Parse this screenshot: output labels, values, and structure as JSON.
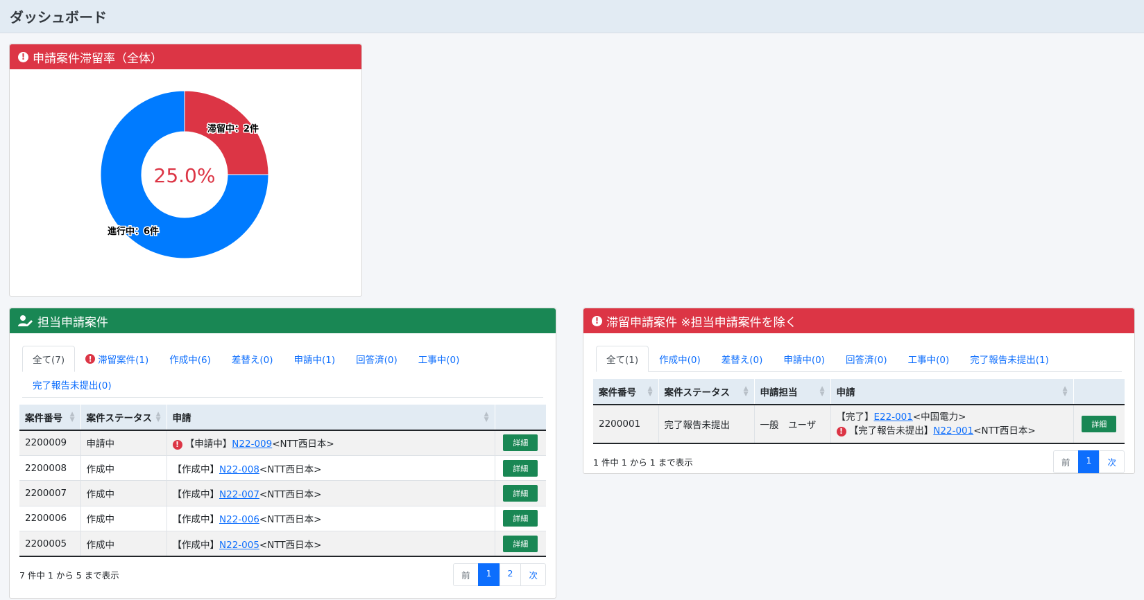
{
  "page": {
    "title": "ダッシュボード"
  },
  "rate_card": {
    "title": "申請案件滞留率（全体）",
    "center_label": "25.0%",
    "slices": [
      {
        "label": "滞留中：2件",
        "value": 2,
        "color": "#dc3545"
      },
      {
        "label": "進行中：6件",
        "value": 6,
        "color": "#007bff"
      }
    ]
  },
  "assigned": {
    "title": "担当申請案件",
    "tabs": [
      "全て(7)",
      "滞留案件(1)",
      "作成中(6)",
      "差替え(0)",
      "申請中(1)",
      "回答済(0)",
      "工事中(0)",
      "完了報告未提出(0)"
    ],
    "columns": [
      "案件番号",
      "案件ステータス",
      "申請"
    ],
    "rows": [
      {
        "no": "2200009",
        "status": "申請中",
        "alert": true,
        "prefix": "【申請中】",
        "link": "N22-009",
        "suffix": "<NTT西日本>"
      },
      {
        "no": "2200008",
        "status": "作成中",
        "alert": false,
        "prefix": "【作成中】",
        "link": "N22-008",
        "suffix": "<NTT西日本>"
      },
      {
        "no": "2200007",
        "status": "作成中",
        "alert": false,
        "prefix": "【作成中】",
        "link": "N22-007",
        "suffix": "<NTT西日本>"
      },
      {
        "no": "2200006",
        "status": "作成中",
        "alert": false,
        "prefix": "【作成中】",
        "link": "N22-006",
        "suffix": "<NTT西日本>"
      },
      {
        "no": "2200005",
        "status": "作成中",
        "alert": false,
        "prefix": "【作成中】",
        "link": "N22-005",
        "suffix": "<NTT西日本>"
      }
    ],
    "detail_label": "詳細",
    "info": "7 件中 1 から 5 まで表示",
    "pager": [
      "前",
      "1",
      "2",
      "次"
    ],
    "current_page": "1"
  },
  "stalled": {
    "title": "滞留申請案件 ※担当申請案件を除く",
    "tabs": [
      "全て(1)",
      "作成中(0)",
      "差替え(0)",
      "申請中(0)",
      "回答済(0)",
      "工事中(0)",
      "完了報告未提出(1)"
    ],
    "columns": [
      "案件番号",
      "案件ステータス",
      "申請担当",
      "申請"
    ],
    "row": {
      "no": "2200001",
      "status": "完了報告未提出",
      "owner": "一般　ユーザ",
      "line1_prefix": "【完了】",
      "line1_link": "E22-001",
      "line1_suffix": "<中国電力>",
      "line2_prefix": "【完了報告未提出】",
      "line2_link": "N22-001",
      "line2_suffix": "<NTT西日本>"
    },
    "detail_label": "詳細",
    "info": "1 件中 1 から 1 まで表示",
    "pager": [
      "前",
      "1",
      "次"
    ],
    "current_page": "1"
  },
  "colors": {
    "danger": "#dc3545",
    "success": "#198754",
    "primary": "#0d6efd",
    "chart_blue": "#007bff"
  },
  "icons": {
    "alert": "alert-icon",
    "user_edit": "user-edit-icon"
  }
}
